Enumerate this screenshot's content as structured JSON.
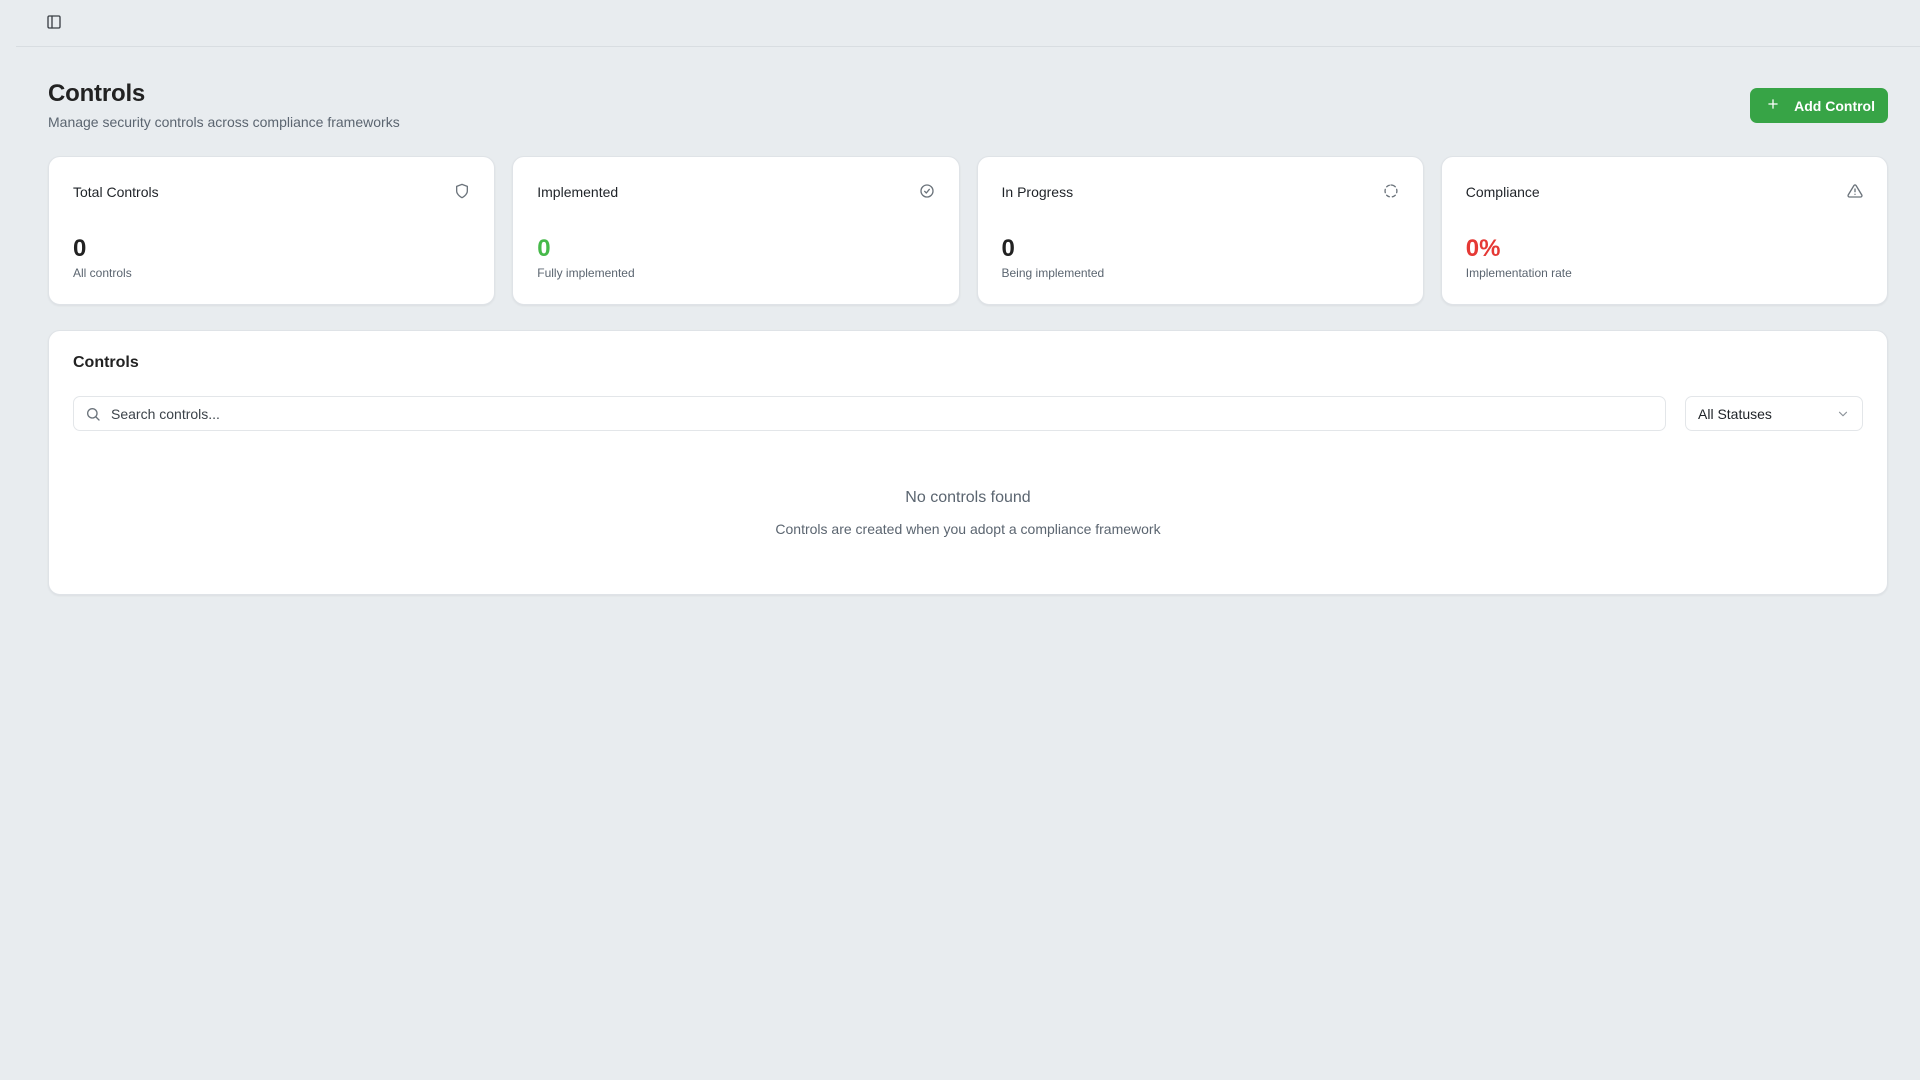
{
  "header": {
    "title": "Controls",
    "subtitle": "Manage security controls across compliance frameworks",
    "add_button_label": "Add Control"
  },
  "stats": [
    {
      "label": "Total Controls",
      "value": "0",
      "caption": "All controls",
      "icon": "shield-icon"
    },
    {
      "label": "Implemented",
      "value": "0",
      "caption": "Fully implemented",
      "icon": "check-circle-icon",
      "color": "#46b94a"
    },
    {
      "label": "In Progress",
      "value": "0",
      "caption": "Being implemented",
      "icon": "loader-icon"
    },
    {
      "label": "Compliance",
      "value": "0%",
      "caption": "Implementation rate",
      "icon": "alert-triangle-icon",
      "color": "#e53935"
    }
  ],
  "panel": {
    "title": "Controls",
    "search_placeholder": "Search controls...",
    "search_value": "",
    "status_filter": "All Statuses",
    "empty_title": "No controls found",
    "empty_subtitle": "Controls are created when you adopt a compliance framework"
  },
  "colors": {
    "accent": "#37a446",
    "background": "#e8ecef",
    "success": "#46b94a",
    "danger": "#e53935"
  }
}
